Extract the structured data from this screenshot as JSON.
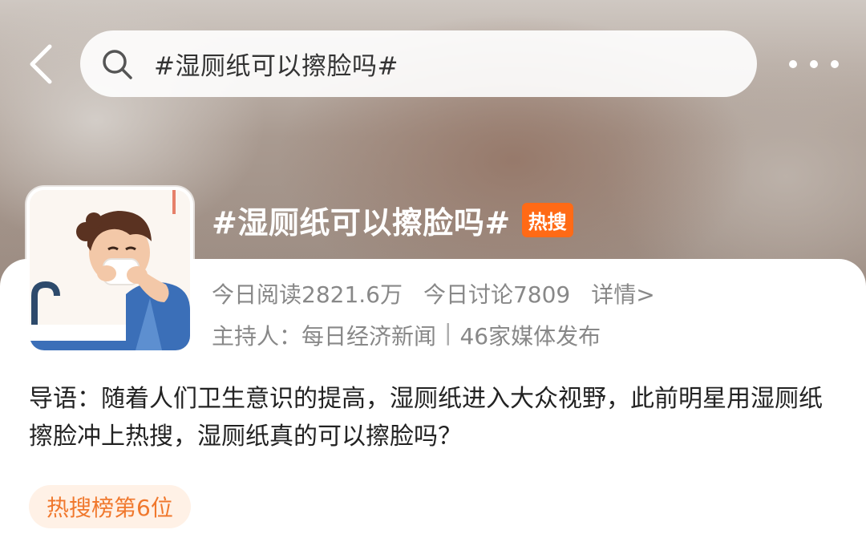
{
  "header": {
    "search_text": "#湿厕纸可以擦脸吗#",
    "icons": {
      "back": "chevron-left-icon",
      "search": "search-icon",
      "more": "more-dots-icon"
    }
  },
  "topic": {
    "title": "#湿厕纸可以擦脸吗#",
    "hot_badge": "热搜",
    "read_stat": "今日阅读2821.6万",
    "discuss_stat": "今日讨论7809",
    "details_link": "详情>",
    "host_label": "主持人：",
    "host_name": "每日经济新闻",
    "separator": "|",
    "media_count": "46家媒体发布",
    "intro": "导语：随着人们卫生意识的提高，湿厕纸进入大众视野，此前明星用湿厕纸擦脸冲上热搜，湿厕纸真的可以擦脸吗？",
    "rank_tag": "热搜榜第6位"
  },
  "colors": {
    "hot_badge": "#ff6a16",
    "rank_tag_text": "#f0782d",
    "rank_tag_bg": "#fff1e6",
    "meta_text": "#888888"
  }
}
